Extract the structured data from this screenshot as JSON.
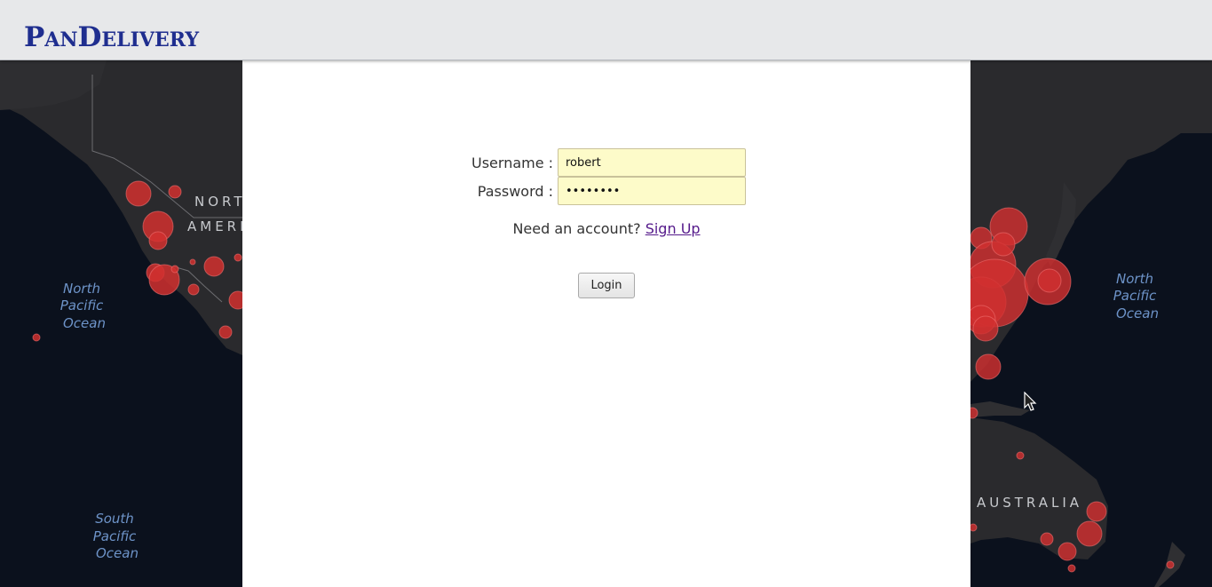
{
  "header": {
    "logo": "PanDelivery"
  },
  "login_form": {
    "username_label": "Username :",
    "username_value": "robert",
    "password_label": "Password :",
    "password_value": "••••••••",
    "signup_prompt": "Need an account?",
    "signup_link": "Sign Up",
    "login_button": "Login"
  },
  "map": {
    "ocean_labels": {
      "north_pacific_left": [
        "North",
        "Pacific",
        "Ocean"
      ],
      "south_pacific": [
        "South",
        "Pacific",
        "Ocean"
      ],
      "north_pacific_right": [
        "North",
        "Pacific",
        "Ocean"
      ]
    },
    "continent_labels": {
      "north_america_1": "NORTH",
      "north_america_2": "AMERICA",
      "australia": "AUSTRALIA"
    },
    "colors": {
      "ocean": "#0c1220",
      "land": "#2a2a2c",
      "marker": "#d32f2f"
    }
  }
}
